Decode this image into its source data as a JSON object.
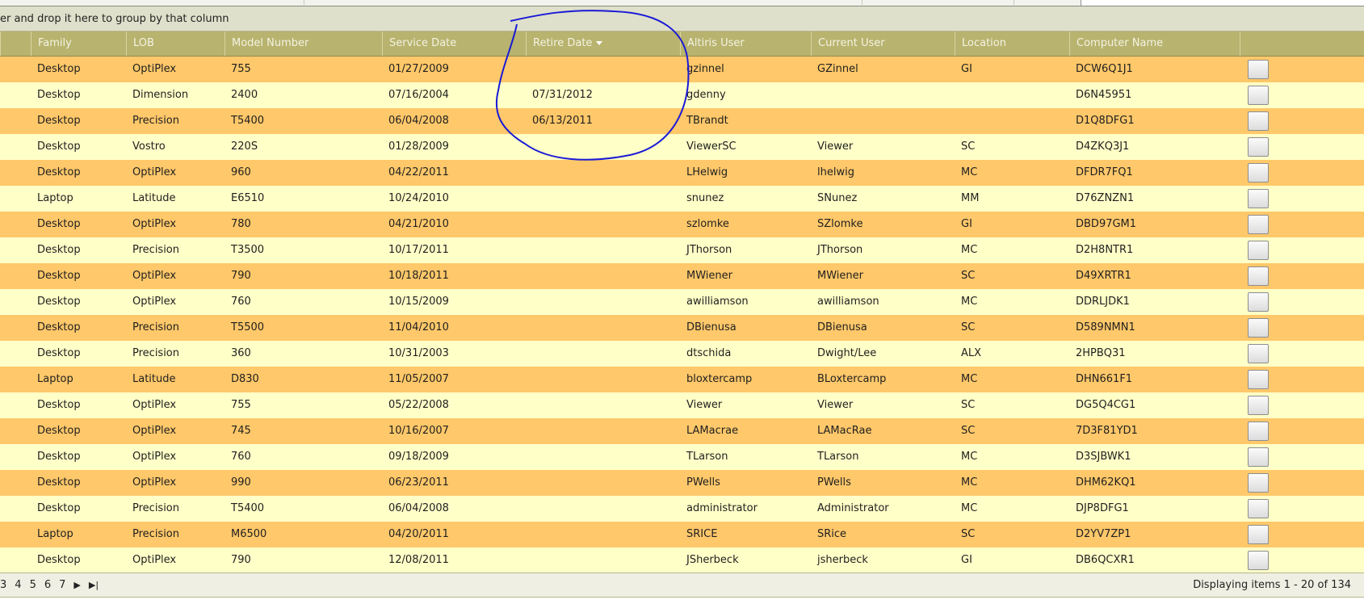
{
  "group_panel": {
    "text": "er and drop it here to group by that column"
  },
  "columns": [
    "Family",
    "LOB",
    "Model Number",
    "Service Date",
    "Retire Date",
    "Altiris User",
    "Current User",
    "Location",
    "Computer Name"
  ],
  "sorted_column": "Retire Date",
  "rows": [
    [
      "Desktop",
      "OptiPlex",
      "755",
      "01/27/2009",
      "",
      "gzinnel",
      "GZinnel",
      "GI",
      "DCW6Q1J1"
    ],
    [
      "Desktop",
      "Dimension",
      "2400",
      "07/16/2004",
      "07/31/2012",
      "gdenny",
      "",
      "",
      "D6N45951"
    ],
    [
      "Desktop",
      "Precision",
      "T5400",
      "06/04/2008",
      "06/13/2011",
      "TBrandt",
      "",
      "",
      "D1Q8DFG1"
    ],
    [
      "Desktop",
      "Vostro",
      "220S",
      "01/28/2009",
      "",
      "ViewerSC",
      "Viewer",
      "SC",
      "D4ZKQ3J1"
    ],
    [
      "Desktop",
      "OptiPlex",
      "960",
      "04/22/2011",
      "",
      "LHelwig",
      "lhelwig",
      "MC",
      "DFDR7FQ1"
    ],
    [
      "Laptop",
      "Latitude",
      "E6510",
      "10/24/2010",
      "",
      "snunez",
      "SNunez",
      "MM",
      "D76ZNZN1"
    ],
    [
      "Desktop",
      "OptiPlex",
      "780",
      "04/21/2010",
      "",
      "szlomke",
      "SZlomke",
      "GI",
      "DBD97GM1"
    ],
    [
      "Desktop",
      "Precision",
      "T3500",
      "10/17/2011",
      "",
      "JThorson",
      "JThorson",
      "MC",
      "D2H8NTR1"
    ],
    [
      "Desktop",
      "OptiPlex",
      "790",
      "10/18/2011",
      "",
      "MWiener",
      "MWiener",
      "SC",
      "D49XRTR1"
    ],
    [
      "Desktop",
      "OptiPlex",
      "760",
      "10/15/2009",
      "",
      "awilliamson",
      "awilliamson",
      "MC",
      "DDRLJDK1"
    ],
    [
      "Desktop",
      "Precision",
      "T5500",
      "11/04/2010",
      "",
      "DBienusa",
      "DBienusa",
      "SC",
      "D589NMN1"
    ],
    [
      "Desktop",
      "Precision",
      "360",
      "10/31/2003",
      "",
      "dtschida",
      "Dwight/Lee",
      "ALX",
      "2HPBQ31"
    ],
    [
      "Laptop",
      "Latitude",
      "D830",
      "11/05/2007",
      "",
      "bloxtercamp",
      "BLoxtercamp",
      "MC",
      "DHN661F1"
    ],
    [
      "Desktop",
      "OptiPlex",
      "755",
      "05/22/2008",
      "",
      "Viewer",
      "Viewer",
      "SC",
      "DG5Q4CG1"
    ],
    [
      "Desktop",
      "OptiPlex",
      "745",
      "10/16/2007",
      "",
      "LAMacrae",
      "LAMacRae",
      "SC",
      "7D3F81YD1"
    ],
    [
      "Desktop",
      "OptiPlex",
      "760",
      "09/18/2009",
      "",
      "TLarson",
      "TLarson",
      "MC",
      "D3SJBWK1"
    ],
    [
      "Desktop",
      "OptiPlex",
      "990",
      "06/23/2011",
      "",
      "PWells",
      "PWells",
      "MC",
      "DHM62KQ1"
    ],
    [
      "Desktop",
      "Precision",
      "T5400",
      "06/04/2008",
      "",
      "administrator",
      "Administrator",
      "MC",
      "DJP8DFG1"
    ],
    [
      "Laptop",
      "Precision",
      "M6500",
      "04/20/2011",
      "",
      "SRICE",
      "SRice",
      "SC",
      "D2YV7ZP1"
    ],
    [
      "Desktop",
      "OptiPlex",
      "790",
      "12/08/2011",
      "",
      "JSherbeck",
      "jsherbeck",
      "GI",
      "DB6QCXR1"
    ]
  ],
  "pager": {
    "pages": [
      "3",
      "4",
      "5",
      "6",
      "7"
    ],
    "status": "Displaying items 1 - 20 of 134"
  },
  "colors": {
    "header": "#b8b36e",
    "row_odd": "#ffc86a",
    "row_even": "#ffffc8",
    "annotation": "#1a1ad6"
  }
}
